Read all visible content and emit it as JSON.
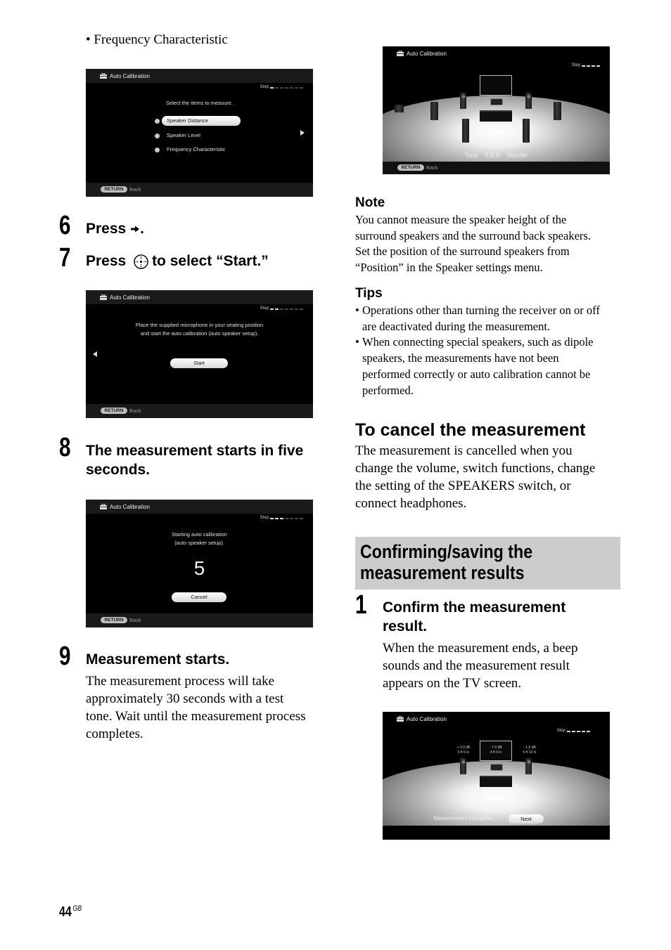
{
  "left_column": {
    "bullet_item": "Frequency Characteristic",
    "steps": [
      {
        "number": "6",
        "title_before": "Press",
        "title_after": ".",
        "icon": "right-arrow-icon"
      },
      {
        "number": "7",
        "title_before": "Press",
        "title_after": "to select “Start.”",
        "icon": "enter-button-icon"
      },
      {
        "number": "8",
        "title_line1": "The measurement starts in five",
        "title_line2": "seconds."
      },
      {
        "number": "9",
        "title": "Measurement starts.",
        "body_lines": [
          "The measurement process will take",
          "approximately 30 seconds with a test",
          "tone. Wait until the measurement process",
          "completes."
        ]
      }
    ]
  },
  "screens": {
    "common": {
      "title": "Auto Calibration",
      "step_label": "Step",
      "return_label": "RETURN",
      "back_label": "Back"
    },
    "select_items": {
      "prompt": "Select the items to measure.",
      "options": [
        "Speaker Distance",
        "Speaker Level",
        "Frequency Characteristic"
      ],
      "selected_index": 0,
      "step_progress": "1 of 7"
    },
    "start": {
      "line1": "Place the supplied microphone in your seating position",
      "line2": "and start the auto calibration (auto speaker setup).",
      "button": "Start",
      "step_progress": "2 of 7"
    },
    "countdown": {
      "line1": "Starting auto calibration",
      "line2": "(auto speaker setup).",
      "count": "5",
      "button": "Cancel",
      "step_progress": "3 of 7"
    },
    "measuring": {
      "phases": [
        "Tone",
        "T.S.P.",
        "Woofer"
      ],
      "step_progress": "4 of 4"
    },
    "complete": {
      "message": "Measurement complete.",
      "button": "Next",
      "step_progress": "5 of 5",
      "left_value_line1": "+ 3.0 dB",
      "left_value_line2": "5 ft 0 in",
      "center_value_line1": "- 7.0 dB",
      "center_value_line2": "4 ft 0 in",
      "right_value_line1": "- 1.5 dB",
      "right_value_line2": "5 ft 10 in"
    }
  },
  "right_column": {
    "note": {
      "heading": "Note",
      "lines": [
        "You cannot measure the speaker height of the",
        "surround speakers and the surround back speakers.",
        "Set the position of the surround speakers from",
        "“Position” in the Speaker settings menu."
      ]
    },
    "tips": {
      "heading": "Tips",
      "items": [
        {
          "lines": [
            "Operations other than turning the receiver on or off",
            "are deactivated during the measurement."
          ]
        },
        {
          "lines": [
            "When connecting special speakers, such as dipole",
            "speakers, the measurements have not been",
            "performed correctly or auto calibration cannot be",
            "performed."
          ]
        }
      ]
    },
    "cancel_section": {
      "heading": "To cancel the measurement",
      "lines": [
        "The measurement is cancelled when you",
        "change the volume, switch functions, change",
        "the setting of the SPEAKERS switch, or",
        "connect headphones."
      ]
    },
    "banner": {
      "line1": "Confirming/saving the",
      "line2": "measurement results"
    },
    "confirm_step": {
      "number": "1",
      "title_line1": "Confirm the measurement",
      "title_line2": "result.",
      "body_lines": [
        "When the measurement ends, a beep",
        "sounds and the measurement result",
        "appears on the TV screen."
      ]
    }
  },
  "footer": {
    "page_number": "44",
    "region": "GB"
  }
}
